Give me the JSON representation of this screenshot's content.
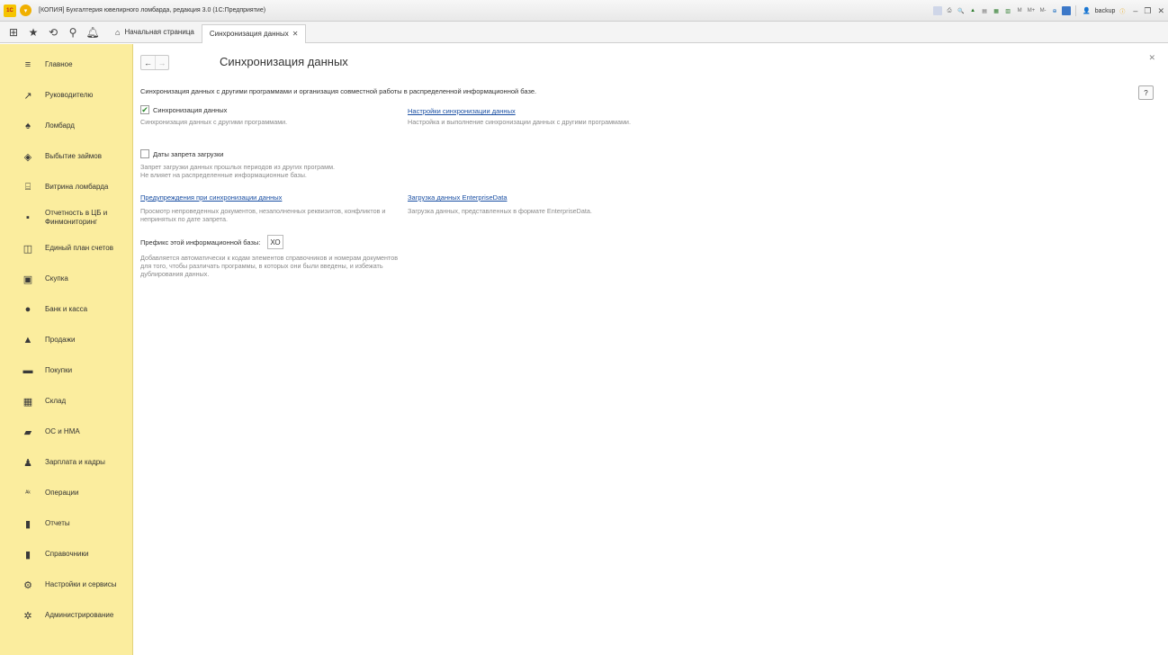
{
  "titlebar": {
    "logo_text": "1С",
    "title": "[КОПИЯ] Бухгалтерия ювелирного ломбарда, редакция 3.0  (1С:Предприятие)",
    "user": "backup",
    "m_labels": [
      "M",
      "M+",
      "M-"
    ]
  },
  "tabs": {
    "home_label": "Начальная страница",
    "active_label": "Синхронизация данных"
  },
  "sidebar": {
    "items": [
      {
        "label": "Главное",
        "icon": "menu-icon"
      },
      {
        "label": "Руководителю",
        "icon": "trend-icon"
      },
      {
        "label": "Ломбард",
        "icon": "money-bag-icon"
      },
      {
        "label": "Выбытие займов",
        "icon": "gem-icon"
      },
      {
        "label": "Витрина ломбарда",
        "icon": "storefront-icon"
      },
      {
        "label": "Отчетность в ЦБ и Финмониторинг",
        "icon": "chart-icon"
      },
      {
        "label": "Единый план счетов",
        "icon": "book-icon"
      },
      {
        "label": "Скупка",
        "icon": "cash-register-icon"
      },
      {
        "label": "Банк и касса",
        "icon": "coin-icon"
      },
      {
        "label": "Продажи",
        "icon": "shopping-bag-icon"
      },
      {
        "label": "Покупки",
        "icon": "cart-icon"
      },
      {
        "label": "Склад",
        "icon": "warehouse-icon"
      },
      {
        "label": "ОС и НМА",
        "icon": "truck-icon"
      },
      {
        "label": "Зарплата и кадры",
        "icon": "person-icon"
      },
      {
        "label": "Операции",
        "icon": "operations-icon"
      },
      {
        "label": "Отчеты",
        "icon": "bar-chart-icon"
      },
      {
        "label": "Справочники",
        "icon": "directory-icon"
      },
      {
        "label": "Настройки и сервисы",
        "icon": "gear-icon"
      },
      {
        "label": "Администрирование",
        "icon": "admin-gear-icon"
      }
    ]
  },
  "main": {
    "title": "Синхронизация данных",
    "help_label": "?",
    "description": "Синхронизация данных с другими программами и организация совместной работы в распределенной информационной базе.",
    "sync": {
      "checked": true,
      "label": "Синхронизация данных",
      "note": "Синхронизация данных с другими программами."
    },
    "sync_settings": {
      "link": "Настройки синхронизации данных",
      "note": "Настройка и выполнение синхронизации данных с другими программами."
    },
    "load_ban": {
      "checked": false,
      "label": "Даты запрета загрузки",
      "note_line1": "Запрет загрузки данных прошлых периодов из других программ.",
      "note_line2": "Не влияет на распределенные информационные базы."
    },
    "warnings": {
      "link": "Предупреждения при синхронизации данных",
      "note": "Просмотр непроведенных документов, незаполненных реквизитов, конфликтов и непринятых по дате запрета."
    },
    "enterprise_data": {
      "link": "Загрузка данных EnterpriseData",
      "note": "Загрузка данных, представленных в формате EnterpriseData."
    },
    "prefix": {
      "label": "Префикс этой информационной базы:",
      "value": "ХО",
      "note": "Добавляется автоматически к кодам элементов справочников и номерам документов для того, чтобы различать программы, в которых они были введены, и избежать дублирования данных."
    }
  }
}
